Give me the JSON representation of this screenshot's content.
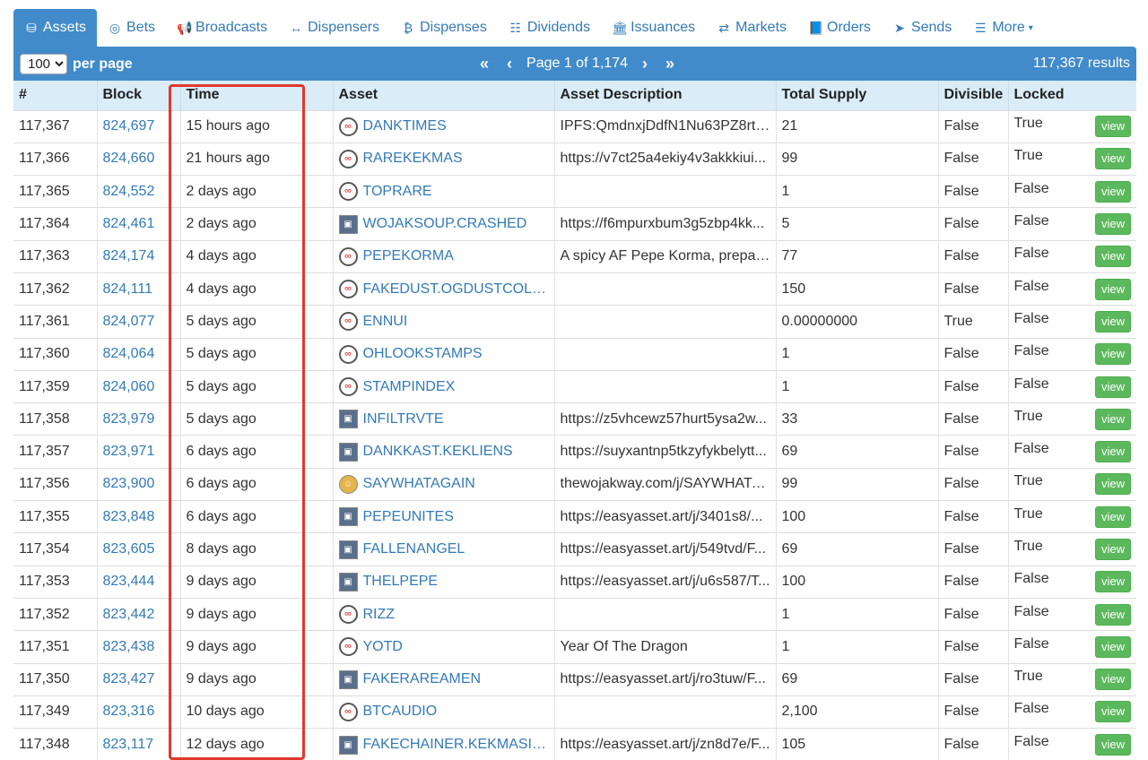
{
  "tabs": [
    {
      "label": "Assets",
      "icon": "database-icon",
      "glyph": "⛁",
      "active": true
    },
    {
      "label": "Bets",
      "icon": "bullseye-icon",
      "glyph": "◎",
      "active": false
    },
    {
      "label": "Broadcasts",
      "icon": "bullhorn-icon",
      "glyph": "📢",
      "active": false
    },
    {
      "label": "Dispensers",
      "icon": "arrows-h-icon",
      "glyph": "↔",
      "active": false
    },
    {
      "label": "Dispenses",
      "icon": "bitcoin-icon",
      "glyph": "₿",
      "active": false
    },
    {
      "label": "Dividends",
      "icon": "sitemap-icon",
      "glyph": "☷",
      "active": false
    },
    {
      "label": "Issuances",
      "icon": "bank-icon",
      "glyph": "🏛",
      "active": false
    },
    {
      "label": "Markets",
      "icon": "exchange-icon",
      "glyph": "⇄",
      "active": false
    },
    {
      "label": "Orders",
      "icon": "book-icon",
      "glyph": "📘",
      "active": false
    },
    {
      "label": "Sends",
      "icon": "paper-plane-icon",
      "glyph": "➤",
      "active": false
    },
    {
      "label": "More",
      "icon": "list-icon",
      "glyph": "☰",
      "active": false,
      "dropdown": true
    }
  ],
  "toolbar": {
    "per_page_value": "100",
    "per_page_label": "per page",
    "first_label": "«",
    "prev_label": "‹",
    "page_text": "Page 1 of 1,174",
    "next_label": "›",
    "last_label": "»",
    "results_text": "117,367 results"
  },
  "table": {
    "columns": [
      "#",
      "Block",
      "Time",
      "",
      "Asset",
      "Asset Description",
      "Total Supply",
      "Divisible",
      "Locked"
    ],
    "view_label": "view",
    "rows": [
      {
        "num": "117,367",
        "block": "824,697",
        "time": "15 hours ago",
        "asset": "DANKTIMES",
        "icon": "generic",
        "desc": "IPFS:QmdnxjDdfN1Nu63PZ8rtg...",
        "supply": "21",
        "divisible": "False",
        "locked": "True"
      },
      {
        "num": "117,366",
        "block": "824,660",
        "time": "21 hours ago",
        "asset": "RAREKEKMAS",
        "icon": "generic",
        "desc": "https://v7ct25a4ekiy4v3akkkiui...",
        "supply": "99",
        "divisible": "False",
        "locked": "True"
      },
      {
        "num": "117,365",
        "block": "824,552",
        "time": "2 days ago",
        "asset": "TOPRARE",
        "icon": "generic",
        "desc": "",
        "supply": "1",
        "divisible": "False",
        "locked": "False"
      },
      {
        "num": "117,364",
        "block": "824,461",
        "time": "2 days ago",
        "asset": "WOJAKSOUP.CRASHED",
        "icon": "image",
        "desc": "https://f6mpurxbum3g5zbp4kk...",
        "supply": "5",
        "divisible": "False",
        "locked": "False"
      },
      {
        "num": "117,363",
        "block": "824,174",
        "time": "4 days ago",
        "asset": "PEPEKORMA",
        "icon": "generic",
        "desc": "A spicy AF Pepe Korma, prepar...",
        "supply": "77",
        "divisible": "False",
        "locked": "False"
      },
      {
        "num": "117,362",
        "block": "824,111",
        "time": "4 days ago",
        "asset": "FAKEDUST.OGDUSTCOLL...",
        "icon": "generic",
        "desc": "",
        "supply": "150",
        "divisible": "False",
        "locked": "False"
      },
      {
        "num": "117,361",
        "block": "824,077",
        "time": "5 days ago",
        "asset": "ENNUI",
        "icon": "generic",
        "desc": "",
        "supply": "0.00000000",
        "divisible": "True",
        "locked": "False"
      },
      {
        "num": "117,360",
        "block": "824,064",
        "time": "5 days ago",
        "asset": "OHLOOKSTAMPS",
        "icon": "generic",
        "desc": "",
        "supply": "1",
        "divisible": "False",
        "locked": "False"
      },
      {
        "num": "117,359",
        "block": "824,060",
        "time": "5 days ago",
        "asset": "STAMPINDEX",
        "icon": "generic",
        "desc": "",
        "supply": "1",
        "divisible": "False",
        "locked": "False"
      },
      {
        "num": "117,358",
        "block": "823,979",
        "time": "5 days ago",
        "asset": "INFILTRVTE",
        "icon": "image",
        "desc": "https://z5vhcewz57hurt5ysa2w...",
        "supply": "33",
        "divisible": "False",
        "locked": "True"
      },
      {
        "num": "117,357",
        "block": "823,971",
        "time": "6 days ago",
        "asset": "DANKKAST.KEKLIENS",
        "icon": "image",
        "desc": "https://suyxantnp5tkzyfykbelytt...",
        "supply": "69",
        "divisible": "False",
        "locked": "False"
      },
      {
        "num": "117,356",
        "block": "823,900",
        "time": "6 days ago",
        "asset": "SAYWHATAGAIN",
        "icon": "image-round",
        "desc": "thewojakway.com/j/SAYWHATA...",
        "supply": "99",
        "divisible": "False",
        "locked": "True"
      },
      {
        "num": "117,355",
        "block": "823,848",
        "time": "6 days ago",
        "asset": "PEPEUNITES",
        "icon": "image",
        "desc": "https://easyasset.art/j/3401s8/...",
        "supply": "100",
        "divisible": "False",
        "locked": "True"
      },
      {
        "num": "117,354",
        "block": "823,605",
        "time": "8 days ago",
        "asset": "FALLENANGEL",
        "icon": "image",
        "desc": "https://easyasset.art/j/549tvd/F...",
        "supply": "69",
        "divisible": "False",
        "locked": "True"
      },
      {
        "num": "117,353",
        "block": "823,444",
        "time": "9 days ago",
        "asset": "THELPEPE",
        "icon": "image",
        "desc": "https://easyasset.art/j/u6s587/T...",
        "supply": "100",
        "divisible": "False",
        "locked": "False"
      },
      {
        "num": "117,352",
        "block": "823,442",
        "time": "9 days ago",
        "asset": "RIZZ",
        "icon": "generic",
        "desc": "",
        "supply": "1",
        "divisible": "False",
        "locked": "False"
      },
      {
        "num": "117,351",
        "block": "823,438",
        "time": "9 days ago",
        "asset": "YOTD",
        "icon": "generic",
        "desc": "Year Of The Dragon",
        "supply": "1",
        "divisible": "False",
        "locked": "False"
      },
      {
        "num": "117,350",
        "block": "823,427",
        "time": "9 days ago",
        "asset": "FAKERAREAMEN",
        "icon": "image",
        "desc": "https://easyasset.art/j/ro3tuw/F...",
        "supply": "69",
        "divisible": "False",
        "locked": "True"
      },
      {
        "num": "117,349",
        "block": "823,316",
        "time": "10 days ago",
        "asset": "BTCAUDIO",
        "icon": "generic",
        "desc": "",
        "supply": "2,100",
        "divisible": "False",
        "locked": "False"
      },
      {
        "num": "117,348",
        "block": "823,117",
        "time": "12 days ago",
        "asset": "FAKECHAINER.KEKMASIT...",
        "icon": "image",
        "desc": "https://easyasset.art/j/zn8d7e/F...",
        "supply": "105",
        "divisible": "False",
        "locked": "False"
      }
    ]
  },
  "colors": {
    "primary": "#428bca",
    "link": "#337ab7",
    "header_bg": "#d9ecf8",
    "view_button": "#5cb85c",
    "highlight": "#e0392b"
  }
}
